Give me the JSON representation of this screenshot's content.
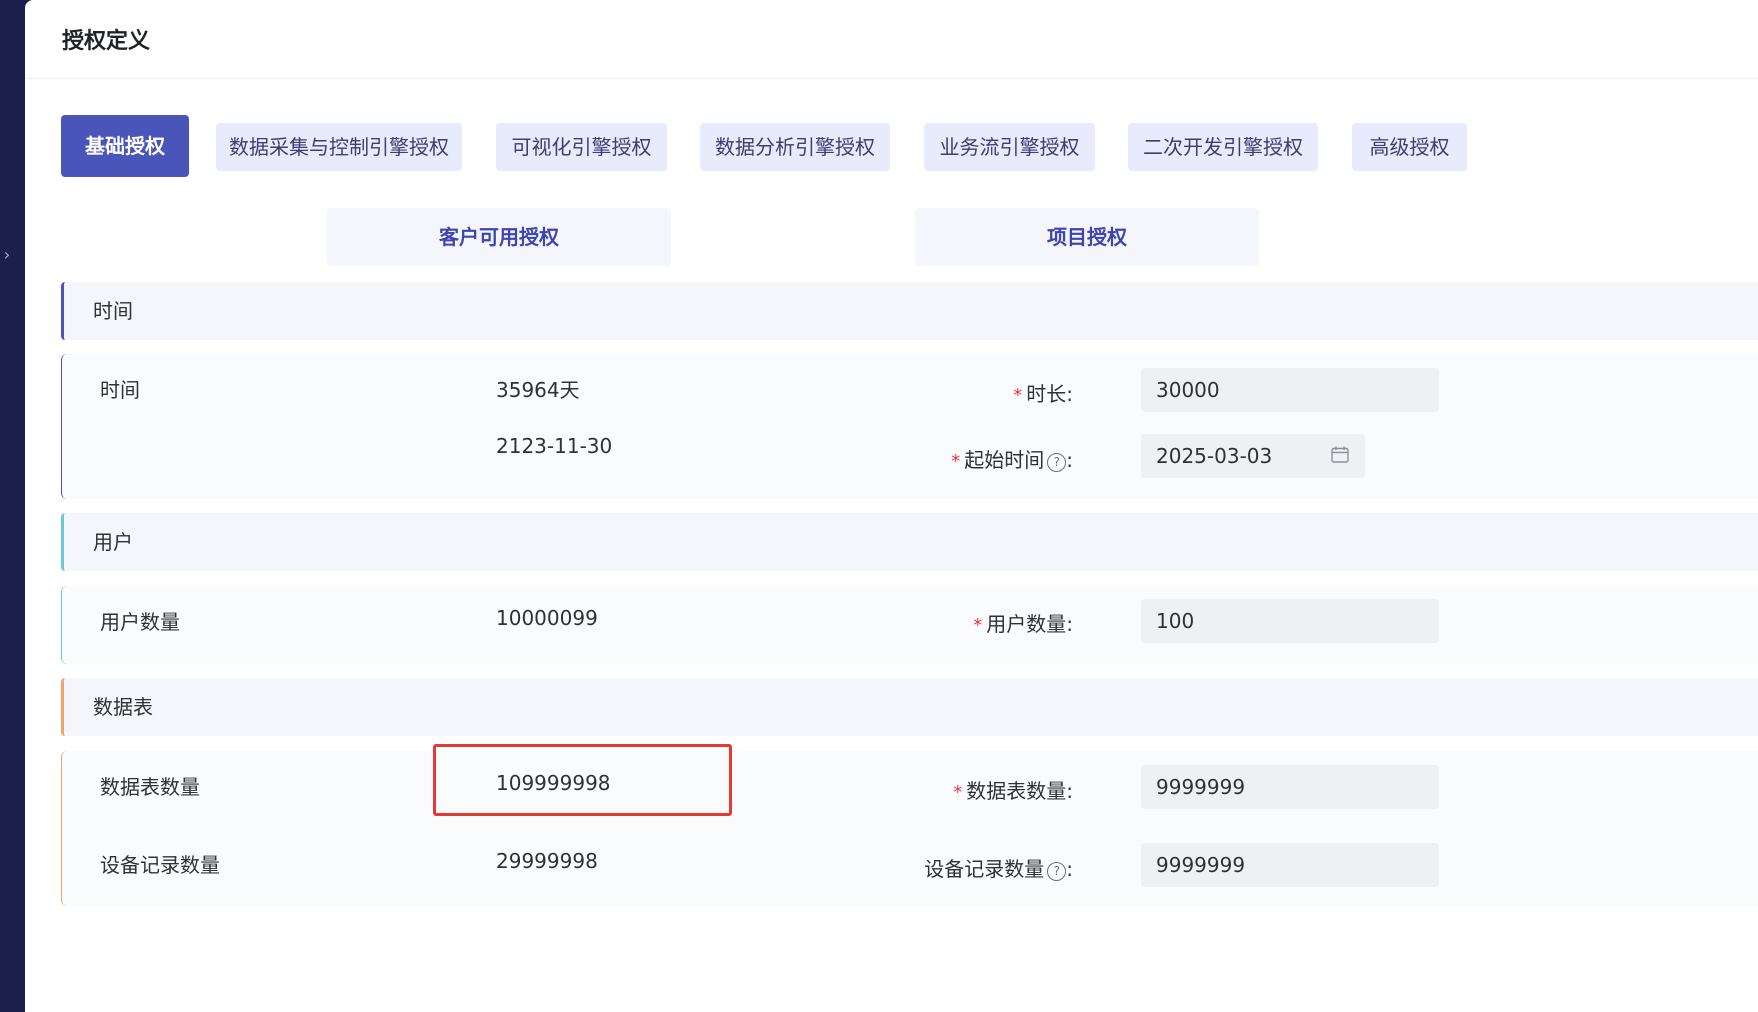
{
  "page": {
    "title": "授权定义"
  },
  "tabs": [
    {
      "label": "基础授权",
      "active": true
    },
    {
      "label": "数据采集与控制引擎授权",
      "active": false
    },
    {
      "label": "可视化引擎授权",
      "active": false
    },
    {
      "label": "数据分析引擎授权",
      "active": false
    },
    {
      "label": "业务流引擎授权",
      "active": false
    },
    {
      "label": "二次开发引擎授权",
      "active": false
    },
    {
      "label": "高级授权",
      "active": false
    }
  ],
  "subtabs": [
    {
      "label": "客户可用授权"
    },
    {
      "label": "项目授权"
    }
  ],
  "sections": {
    "time": {
      "title": "时间",
      "row_label": "时间",
      "days_value": "35964天",
      "end_date_value": "2123-11-30",
      "duration_label": "时长",
      "duration_value": "30000",
      "start_label": "起始时间",
      "start_value": "2025-03-03"
    },
    "user": {
      "title": "用户",
      "row_label": "用户数量",
      "value": "10000099",
      "form_label": "用户数量",
      "input_value": "100"
    },
    "table": {
      "title": "数据表",
      "table_count_label": "数据表数量",
      "table_count_value": "109999998",
      "table_count_form_label": "数据表数量",
      "table_count_input": "9999999",
      "device_label": "设备记录数量",
      "device_value": "29999998",
      "device_form_label": "设备记录数量",
      "device_input": "9999999"
    }
  },
  "symbols": {
    "required_mark": "*",
    "help_mark": "?",
    "colon": ":",
    "rail_chevron": "›"
  },
  "colors": {
    "accent": "#4a55b9",
    "highlight": "#e53935",
    "user_section": "#6cc8d6",
    "table_section": "#f0a46a"
  }
}
